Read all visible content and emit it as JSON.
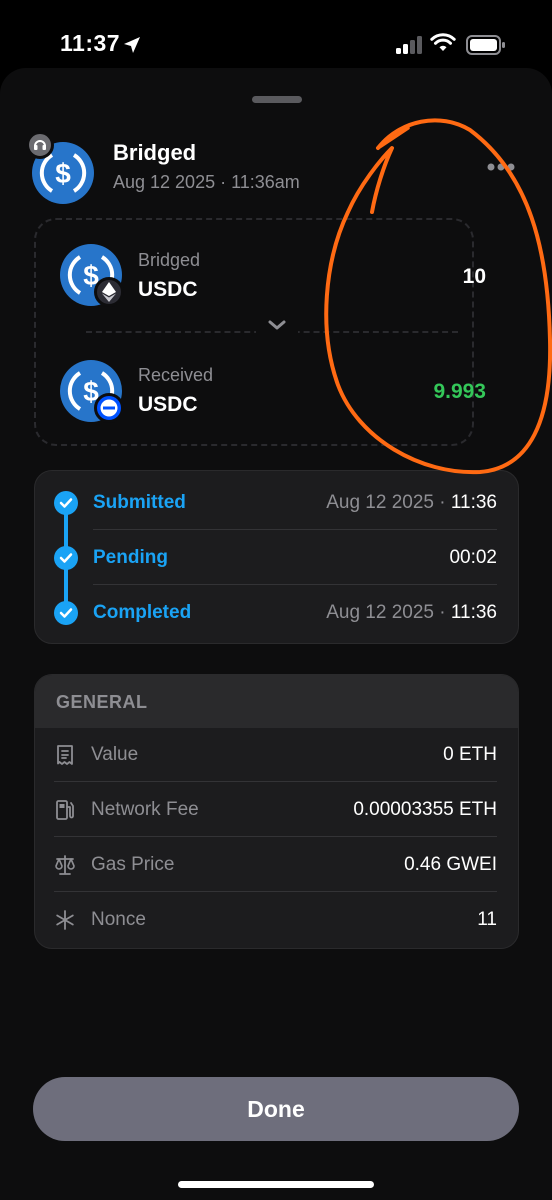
{
  "status_bar": {
    "time": "11:37"
  },
  "header": {
    "title": "Bridged",
    "subtitle": "Aug 12 2025 · 11:36am"
  },
  "transfer": {
    "sent": {
      "label": "Bridged",
      "token": "USDC",
      "amount": "10",
      "chain_icon": "ethereum-icon"
    },
    "received": {
      "label": "Received",
      "token": "USDC",
      "amount": "9.993",
      "chain_icon": "base-icon"
    }
  },
  "timeline": [
    {
      "label": "Submitted",
      "date": "Aug 12 2025",
      "sep": " · ",
      "time": "11:36"
    },
    {
      "label": "Pending",
      "date": "",
      "sep": "",
      "time": "00:02"
    },
    {
      "label": "Completed",
      "date": "Aug 12 2025",
      "sep": " · ",
      "time": "11:36"
    }
  ],
  "general": {
    "title": "GENERAL",
    "rows": [
      {
        "icon": "receipt-icon",
        "label": "Value",
        "value": "0 ETH"
      },
      {
        "icon": "fuel-pump-icon",
        "label": "Network Fee",
        "value": "0.00003355 ETH"
      },
      {
        "icon": "scale-icon",
        "label": "Gas Price",
        "value": "0.46 GWEI"
      },
      {
        "icon": "asterisk-icon",
        "label": "Nonce",
        "value": "11"
      }
    ]
  },
  "done_label": "Done",
  "colors": {
    "accent": "#1aa3f5",
    "usdc_blue": "#2775ca",
    "received_green": "#34c759",
    "annotation_orange": "#ff6a13"
  }
}
